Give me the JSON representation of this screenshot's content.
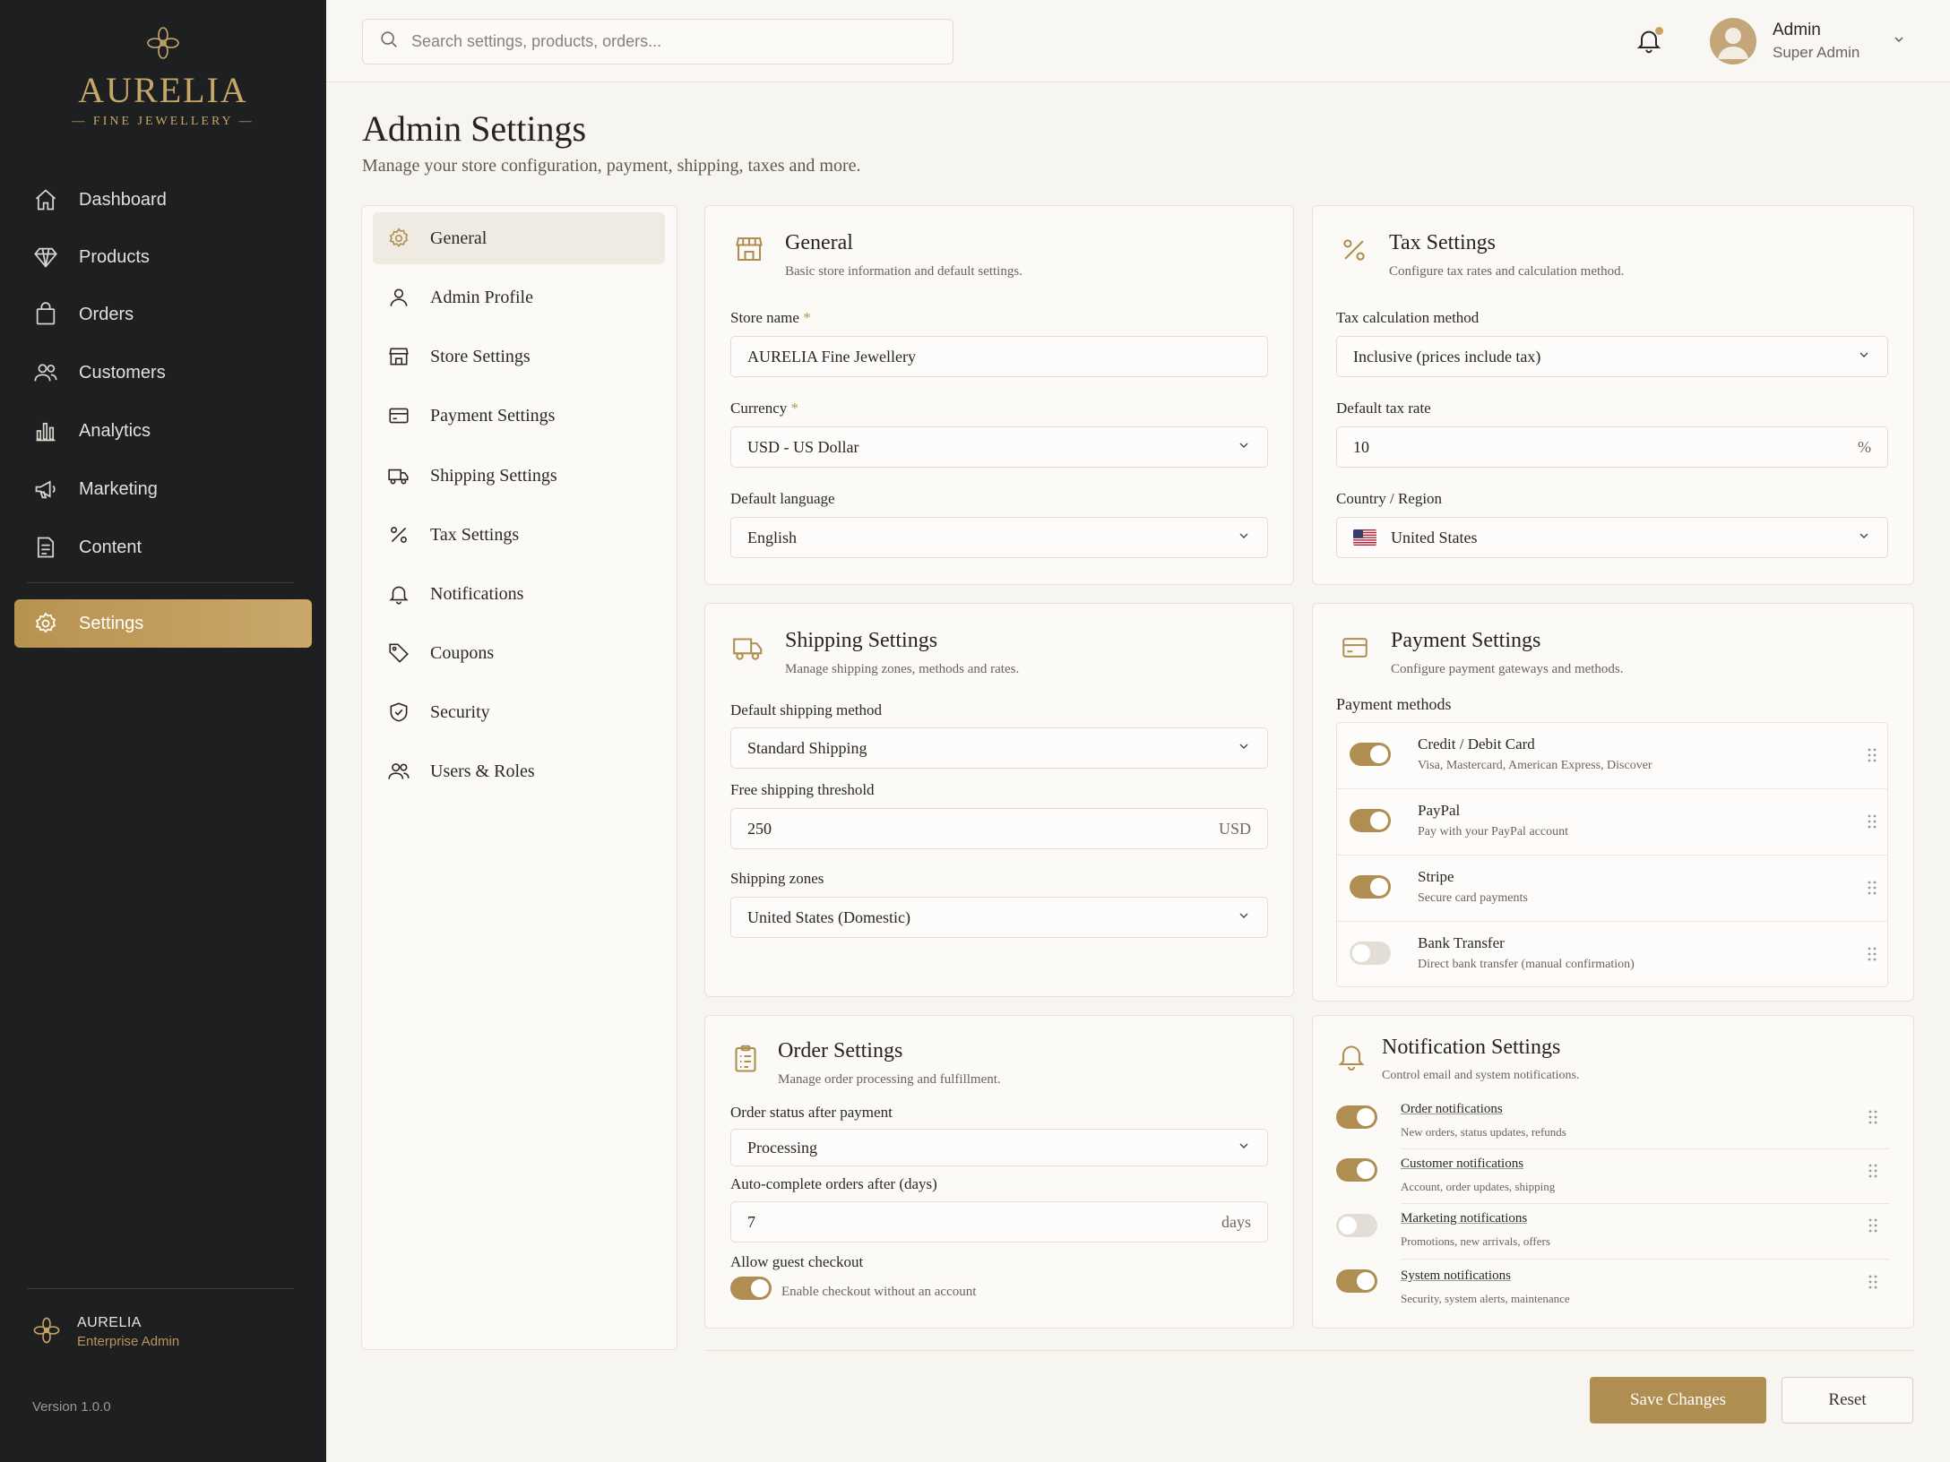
{
  "brand": {
    "name": "AURELIA",
    "tagline": "— FINE JEWELLERY —"
  },
  "sidebar": {
    "items": [
      {
        "label": "Dashboard",
        "icon": "home-icon"
      },
      {
        "label": "Products",
        "icon": "diamond-icon"
      },
      {
        "label": "Orders",
        "icon": "bag-icon"
      },
      {
        "label": "Customers",
        "icon": "users-icon"
      },
      {
        "label": "Analytics",
        "icon": "bar-chart-icon"
      },
      {
        "label": "Marketing",
        "icon": "megaphone-icon"
      },
      {
        "label": "Content",
        "icon": "document-icon"
      },
      {
        "label": "Settings",
        "icon": "gear-icon",
        "active": true
      }
    ],
    "footer": {
      "name": "AURELIA",
      "plan": "Enterprise Admin",
      "version": "Version 1.0.0"
    }
  },
  "topbar": {
    "search_placeholder": "Search settings, products, orders...",
    "user": {
      "name": "Admin",
      "role": "Super Admin"
    }
  },
  "page": {
    "title": "Admin Settings",
    "subtitle": "Manage your store configuration, payment, shipping, taxes and more."
  },
  "settings_menu": [
    {
      "label": "General",
      "active": true
    },
    {
      "label": "Admin Profile"
    },
    {
      "label": "Store Settings"
    },
    {
      "label": "Payment Settings"
    },
    {
      "label": "Shipping Settings"
    },
    {
      "label": "Tax Settings"
    },
    {
      "label": "Notifications"
    },
    {
      "label": "Coupons"
    },
    {
      "label": "Security"
    },
    {
      "label": "Users & Roles"
    }
  ],
  "general": {
    "title": "General",
    "subtitle": "Basic store information and default settings.",
    "store_name_label": "Store name",
    "store_name": "AURELIA Fine Jewellery",
    "currency_label": "Currency",
    "currency": "USD - US Dollar",
    "language_label": "Default language",
    "language": "English"
  },
  "tax": {
    "title": "Tax Settings",
    "subtitle": "Configure tax rates and calculation method.",
    "method_label": "Tax calculation method",
    "method": "Inclusive (prices include tax)",
    "rate_label": "Default tax rate",
    "rate": "10",
    "rate_suffix": "%",
    "country_label": "Country / Region",
    "country": "United States"
  },
  "shipping": {
    "title": "Shipping Settings",
    "subtitle": "Manage shipping zones, methods and rates.",
    "method_label": "Default shipping method",
    "method": "Standard Shipping",
    "threshold_label": "Free shipping threshold",
    "threshold": "250",
    "threshold_suffix": "USD",
    "zones_label": "Shipping zones",
    "zones": "United States (Domestic)"
  },
  "payment": {
    "title": "Payment Settings",
    "subtitle": "Configure payment gateways and methods.",
    "methods_label": "Payment methods",
    "methods": [
      {
        "name": "Credit / Debit Card",
        "desc": "Visa, Mastercard, American Express, Discover",
        "enabled": true
      },
      {
        "name": "PayPal",
        "desc": "Pay with your PayPal account",
        "enabled": true
      },
      {
        "name": "Stripe",
        "desc": "Secure card payments",
        "enabled": true
      },
      {
        "name": "Bank Transfer",
        "desc": "Direct bank transfer (manual confirmation)",
        "enabled": false
      }
    ]
  },
  "orders": {
    "title": "Order Settings",
    "subtitle": "Manage order processing and fulfillment.",
    "status_label": "Order status after payment",
    "status": "Processing",
    "autocomplete_label": "Auto-complete orders after (days)",
    "autocomplete": "7",
    "autocomplete_suffix": "days",
    "guest_label": "Allow guest checkout",
    "guest_desc": "Enable checkout without an account",
    "guest_enabled": true
  },
  "notifications": {
    "title": "Notification Settings",
    "subtitle": "Control email and system notifications.",
    "items": [
      {
        "name": "Order notifications",
        "desc": "New orders, status updates, refunds",
        "enabled": true
      },
      {
        "name": "Customer notifications",
        "desc": "Account, order updates, shipping",
        "enabled": true
      },
      {
        "name": "Marketing notifications",
        "desc": "Promotions, new arrivals, offers",
        "enabled": false
      },
      {
        "name": "System notifications",
        "desc": "Security, system alerts, maintenance",
        "enabled": true
      }
    ]
  },
  "actions": {
    "save": "Save Changes",
    "reset": "Reset"
  },
  "colors": {
    "accent": "#b08e52",
    "sidebar_bg": "#1e1f21",
    "page_bg": "#f7f5f0"
  }
}
